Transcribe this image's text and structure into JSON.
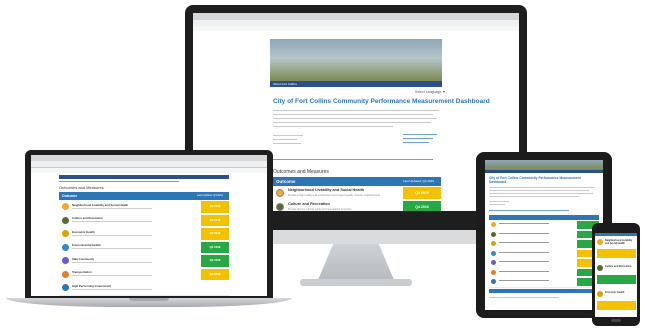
{
  "desktop": {
    "title": "City of Fort Collins Community Performance Measurement Dashboard",
    "nav_label": "About Fort Collins",
    "lang_label": "Select Language ▼",
    "section_heading": "Outcomes and Measures",
    "table_header": "Outcome",
    "table_header_right": "Last Updated: Q4 2019",
    "rows": [
      {
        "label": "Neighborhood Livability and Social Health",
        "sub": "Provide a high quality built environment and support quality, diverse neighborhoods.",
        "badge": "Q4 2019",
        "color": "#f2c200",
        "icon": "#f5a623"
      },
      {
        "label": "Culture and Recreation",
        "sub": "Provide diverse cultural, parks and recreational amenities.",
        "badge": "Q4 2019",
        "color": "#28a845",
        "icon": "#556b2f"
      },
      {
        "label": "Economic Health",
        "sub": "Promote a healthy, sustainable economy.",
        "badge": "Q4 2019",
        "color": "#28a845",
        "icon": "#e0a100"
      }
    ]
  },
  "laptop": {
    "section_heading": "Outcomes and Measures",
    "table_header": "Outcome",
    "table_header_right": "Last Updated: Q4 2019",
    "rows": [
      {
        "label": "Neighborhood Livability and Social Health",
        "badge": "Q4 2019",
        "color": "#f2c200",
        "icon": "#f5a623"
      },
      {
        "label": "Culture and Recreation",
        "badge": "Q4 2019",
        "color": "#f2c200",
        "icon": "#556b2f"
      },
      {
        "label": "Economic Health",
        "badge": "Q4 2019",
        "color": "#f2c200",
        "icon": "#e0a100"
      },
      {
        "label": "Environmental Health",
        "badge": "Q4 2019",
        "color": "#28a845",
        "icon": "#3a87c8"
      },
      {
        "label": "Safe Community",
        "badge": "Q4 2019",
        "color": "#28a845",
        "icon": "#6a5acd"
      },
      {
        "label": "Transportation",
        "badge": "Q4 2019",
        "color": "#f2c200",
        "icon": "#e67e22"
      },
      {
        "label": "High Performing Government",
        "badge": "",
        "color": "#ffffff",
        "icon": "#2e75b6"
      }
    ]
  },
  "tablet": {
    "title": "City of Fort Collins Community Performance Measurement Dashboard",
    "rows": [
      {
        "color": "#28a845",
        "icon": "#f5a623"
      },
      {
        "color": "#28a845",
        "icon": "#556b2f"
      },
      {
        "color": "#28a845",
        "icon": "#e0a100"
      },
      {
        "color": "#f2c200",
        "icon": "#3a87c8"
      },
      {
        "color": "#f2c200",
        "icon": "#6a5acd"
      },
      {
        "color": "#28a845",
        "icon": "#e67e22"
      },
      {
        "color": "#28a845",
        "icon": "#2e75b6"
      }
    ]
  },
  "phone": {
    "rows": [
      {
        "label": "Neighborhood Livability and Social Health",
        "color": "#f2c200",
        "icon": "#f5a623"
      },
      {
        "label": "Culture and Recreation",
        "color": "#28a845",
        "icon": "#556b2f"
      },
      {
        "label": "Economic Health",
        "color": "#f2c200",
        "icon": "#e0a100"
      }
    ]
  },
  "colors": {
    "primary": "#2e75b6",
    "nav": "#2b4f86",
    "green": "#28a845",
    "yellow": "#f2c200"
  }
}
